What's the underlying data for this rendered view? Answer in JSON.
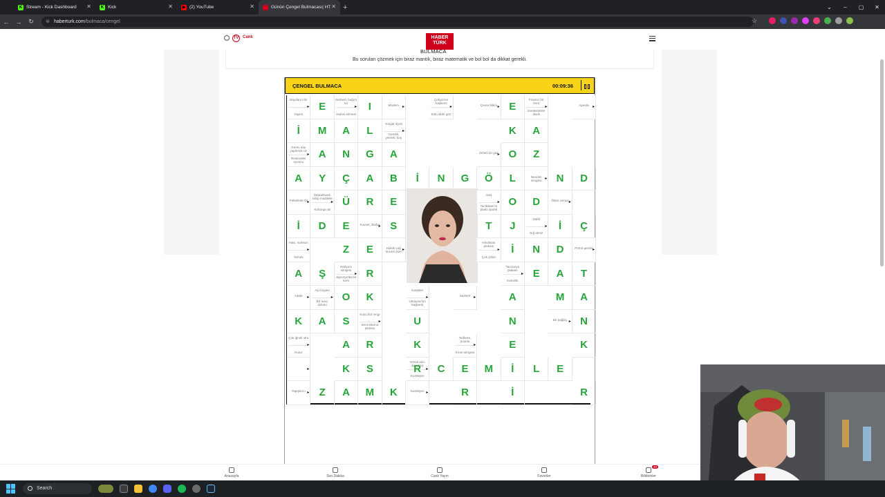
{
  "browser": {
    "tabs": [
      {
        "label": "Stream - Kick Dashboard",
        "favicon": "K",
        "color": "#53fc18",
        "active": false
      },
      {
        "label": "Kick",
        "favicon": "K",
        "color": "#53fc18",
        "active": false
      },
      {
        "label": "(2) YouTube",
        "favicon": "▶",
        "color": "#ff0000",
        "active": false
      },
      {
        "label": "Günün Çengel Bulmacası| HT B...",
        "favicon": "",
        "color": "#d0021b",
        "active": true
      }
    ],
    "url_host": "haberturk.com",
    "url_path": "/bulmaca/cengel"
  },
  "site": {
    "live_label": "Canlı",
    "tv_badge": "TV",
    "logo_top": "HABER",
    "logo_bottom": "TÜRK",
    "logo_sub": "BULMACA",
    "intro": "Bu soruları çözmek için biraz mantık, biraz matematik ve bol bol da dikkat gerekli."
  },
  "puzzle": {
    "title": "ÇENGEL BULMACA",
    "timer": "00:09:36",
    "letters": [
      [
        1,
        1,
        "E"
      ],
      [
        1,
        3,
        "I"
      ],
      [
        1,
        9,
        "E"
      ],
      [
        2,
        0,
        "İ"
      ],
      [
        2,
        1,
        "M"
      ],
      [
        2,
        2,
        "A"
      ],
      [
        2,
        3,
        "L"
      ],
      [
        2,
        9,
        "K"
      ],
      [
        2,
        10,
        "A"
      ],
      [
        3,
        1,
        "A"
      ],
      [
        3,
        2,
        "N"
      ],
      [
        3,
        3,
        "G"
      ],
      [
        3,
        4,
        "A"
      ],
      [
        3,
        9,
        "O"
      ],
      [
        3,
        10,
        "Z"
      ],
      [
        4,
        0,
        "A"
      ],
      [
        4,
        1,
        "Y"
      ],
      [
        4,
        2,
        "Ç"
      ],
      [
        4,
        3,
        "A"
      ],
      [
        4,
        4,
        "B"
      ],
      [
        4,
        5,
        "İ"
      ],
      [
        4,
        6,
        "N"
      ],
      [
        4,
        7,
        "G"
      ],
      [
        4,
        8,
        "Ö"
      ],
      [
        4,
        9,
        "L"
      ],
      [
        4,
        11,
        "N"
      ],
      [
        4,
        12,
        "D"
      ],
      [
        5,
        2,
        "Ü"
      ],
      [
        5,
        3,
        "R"
      ],
      [
        5,
        4,
        "E"
      ],
      [
        5,
        9,
        "O"
      ],
      [
        5,
        10,
        "D"
      ],
      [
        6,
        0,
        "İ"
      ],
      [
        6,
        1,
        "D"
      ],
      [
        6,
        2,
        "E"
      ],
      [
        6,
        4,
        "S"
      ],
      [
        6,
        8,
        "T"
      ],
      [
        6,
        9,
        "J"
      ],
      [
        6,
        11,
        "İ"
      ],
      [
        6,
        12,
        "Ç"
      ],
      [
        7,
        2,
        "Z"
      ],
      [
        7,
        3,
        "E"
      ],
      [
        7,
        9,
        "İ"
      ],
      [
        7,
        10,
        "N"
      ],
      [
        7,
        11,
        "D"
      ],
      [
        8,
        0,
        "A"
      ],
      [
        8,
        1,
        "Ş"
      ],
      [
        8,
        3,
        "R"
      ],
      [
        8,
        10,
        "E"
      ],
      [
        8,
        11,
        "A"
      ],
      [
        8,
        12,
        "T"
      ],
      [
        9,
        2,
        "O"
      ],
      [
        9,
        3,
        "K"
      ],
      [
        9,
        9,
        "A"
      ],
      [
        9,
        11,
        "M"
      ],
      [
        9,
        12,
        "A"
      ],
      [
        10,
        0,
        "K"
      ],
      [
        10,
        1,
        "A"
      ],
      [
        10,
        2,
        "S"
      ],
      [
        10,
        5,
        "U"
      ],
      [
        10,
        9,
        "N"
      ],
      [
        10,
        12,
        "N"
      ],
      [
        11,
        2,
        "A"
      ],
      [
        11,
        3,
        "R"
      ],
      [
        11,
        5,
        "K"
      ],
      [
        11,
        9,
        "E"
      ],
      [
        11,
        12,
        "K"
      ],
      [
        12,
        2,
        "K"
      ],
      [
        12,
        3,
        "S"
      ],
      [
        12,
        5,
        "R"
      ],
      [
        12,
        6,
        "C"
      ],
      [
        12,
        7,
        "E"
      ],
      [
        12,
        8,
        "M"
      ],
      [
        12,
        9,
        "İ"
      ],
      [
        12,
        10,
        "L"
      ],
      [
        12,
        11,
        "E"
      ],
      [
        13,
        1,
        "Z"
      ],
      [
        13,
        2,
        "A"
      ],
      [
        13,
        3,
        "M"
      ],
      [
        13,
        4,
        "K"
      ],
      [
        13,
        7,
        "R"
      ],
      [
        13,
        9,
        "İ"
      ],
      [
        13,
        12,
        "R"
      ]
    ],
    "clues": [
      [
        1,
        0,
        "Baydam cilo",
        "Yapım"
      ],
      [
        1,
        2,
        "Serbest, bağım sız",
        "Hamsi sirmesi"
      ],
      [
        1,
        4,
        "Modem",
        ""
      ],
      [
        1,
        6,
        "Çekya'nın başkenti",
        "Eski dilde göz"
      ],
      [
        1,
        8,
        "Çevre bilimi",
        ""
      ],
      [
        1,
        10,
        "Fransız bir kent",
        "Gereksinilen eksik"
      ],
      [
        1,
        12,
        "Ajanda",
        ""
      ],
      [
        2,
        4,
        "Yozgat ilçesi",
        "Gerekli, yemek, boş"
      ],
      [
        3,
        0,
        "Görev dışı yapılmak üz",
        "Resimdeki oyuncu"
      ],
      [
        3,
        8,
        "Zehirli bir gaz",
        ""
      ],
      [
        4,
        10,
        "Neodim simgesi",
        ""
      ],
      [
        5,
        0,
        "Felsefede fiil",
        ""
      ],
      [
        5,
        1,
        "İskandinavlı rahip maddele",
        "Koburga alt"
      ],
      [
        5,
        8,
        "Ateş",
        "Tacikistan'ın plaka işareti"
      ],
      [
        5,
        11,
        "Ölüm cezası",
        ""
      ],
      [
        6,
        3,
        "Kuvvet, iktidar",
        ""
      ],
      [
        6,
        10,
        "Dahil",
        "Sığ deniz"
      ],
      [
        7,
        0,
        "Hats, mahsun",
        "Yemek"
      ],
      [
        7,
        4,
        "Klasik çağ öncesi eser",
        ""
      ],
      [
        7,
        8,
        "Hindistan plakası",
        "Çok çirkin"
      ],
      [
        7,
        12,
        "Petrol gemisi",
        ""
      ],
      [
        8,
        2,
        "Radyum simgesi",
        "Japonya'da bir kent"
      ],
      [
        8,
        9,
        "Tanzanya plakası",
        "Kamelik"
      ],
      [
        9,
        0,
        "Adale",
        ""
      ],
      [
        9,
        1,
        "Aşı boyası",
        "Bir avuç dolusu"
      ],
      [
        9,
        5,
        "Karakter",
        "Ukrayna'nın başkenti"
      ],
      [
        9,
        7,
        "Muhteli",
        ""
      ],
      [
        10,
        3,
        "Koyu kül rengi",
        "Sent Marino plakası"
      ],
      [
        10,
        11,
        "Bir bağlaç",
        ""
      ],
      [
        11,
        0,
        "Çok iğneli olta",
        "Kutur"
      ],
      [
        11,
        7,
        "Tedkere, pusula",
        "Krom simgesi"
      ],
      [
        12,
        0,
        "",
        ""
      ],
      [
        12,
        5,
        "Gönül alıcı davranış",
        "Kurdeşen"
      ],
      [
        13,
        0,
        "Yapıştırıcı",
        ""
      ],
      [
        13,
        5,
        "Kurdeşen",
        ""
      ]
    ]
  },
  "bottom_nav": [
    {
      "label": "Anasayfa",
      "icon": "home-icon"
    },
    {
      "label": "Son Dakika",
      "icon": "fire-icon"
    },
    {
      "label": "Canlı Yayın",
      "icon": "tv-icon"
    },
    {
      "label": "Favoriler",
      "icon": "bookmark-icon"
    },
    {
      "label": "Bildirimler",
      "icon": "bell-icon",
      "badge": "20"
    }
  ],
  "taskbar": {
    "search_placeholder": "Search"
  }
}
